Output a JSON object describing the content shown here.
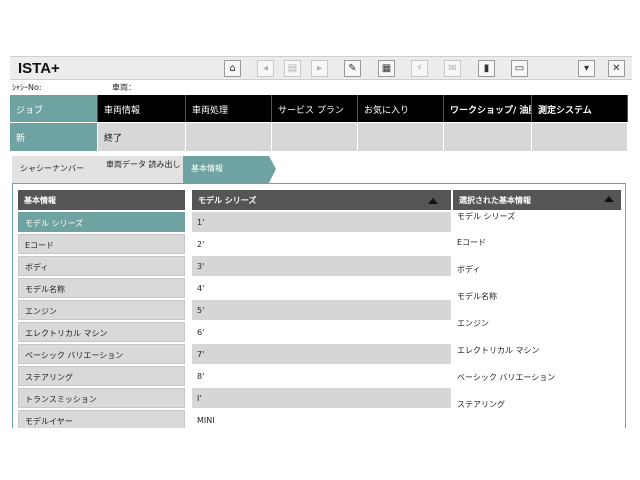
{
  "app": {
    "title": "ISTA+"
  },
  "toolbar": {
    "icons": [
      "home-icon",
      "back-icon",
      "document-icon",
      "forward-icon",
      "wrench-icon",
      "display-icon",
      "link-icon",
      "mail-icon",
      "battery-icon",
      "print-icon",
      "minimize-icon",
      "close-icon"
    ]
  },
  "info": {
    "chassis_label": "ｼｬｼｰNo:",
    "vehicle_label": "車両："
  },
  "main_nav": {
    "items": [
      {
        "label": "ジョブ"
      },
      {
        "label": "車両情報"
      },
      {
        "label": "車両処理"
      },
      {
        "label": "サービス プラン"
      },
      {
        "label": "お気に入り"
      },
      {
        "label": "ワークショップ/ 油脂類"
      },
      {
        "label": "測定システム"
      }
    ]
  },
  "sub_nav": {
    "items": [
      {
        "label": "新"
      },
      {
        "label": "終了"
      },
      {
        "label": ""
      },
      {
        "label": ""
      },
      {
        "label": ""
      },
      {
        "label": ""
      },
      {
        "label": ""
      }
    ]
  },
  "breadcrumb": {
    "items": [
      {
        "label": "シャシーナンバー"
      },
      {
        "label": "車両データ 読み出し"
      },
      {
        "label": "基本情報"
      }
    ]
  },
  "basic_info": {
    "header": "基本情報",
    "items": [
      "モデル シリーズ",
      "Eコード",
      "ボディ",
      "モデル名称",
      "エンジン",
      "エレクトリカル マシン",
      "ベーシック バリエーション",
      "ステアリング",
      "トランスミッション",
      "モデルイヤー"
    ]
  },
  "model_series": {
    "header": "モデル シリーズ",
    "items": [
      "1'",
      "2'",
      "3'",
      "4'",
      "5'",
      "6'",
      "7'",
      "8'",
      "I'",
      "MINI"
    ]
  },
  "selected_info": {
    "header": "選択された基本情報",
    "items": [
      "モデル シリーズ",
      "Eコード",
      "ボディ",
      "モデル名称",
      "エンジン",
      "エレクトリカル マシン",
      "ベーシック バリエーション",
      "ステアリング"
    ]
  },
  "colors": {
    "accent": "#6fa3a1",
    "nav_bg": "#000000",
    "header_bg": "#555555"
  }
}
